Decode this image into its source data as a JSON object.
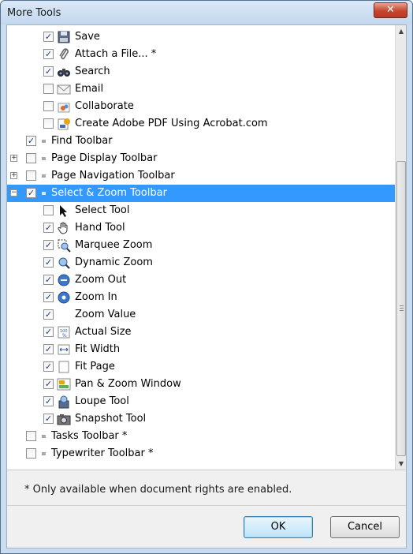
{
  "window": {
    "title": "More Tools",
    "close_glyph": "✕"
  },
  "items": [
    {
      "label": "Save",
      "checked": true,
      "indent": 2,
      "icon": "save-icon",
      "expander": ""
    },
    {
      "label": "Attach a File... *",
      "checked": true,
      "indent": 2,
      "icon": "paperclip-icon",
      "expander": ""
    },
    {
      "label": "Search",
      "checked": true,
      "indent": 2,
      "icon": "binoculars-icon",
      "expander": ""
    },
    {
      "label": "Email",
      "checked": false,
      "indent": 2,
      "icon": "email-icon",
      "expander": ""
    },
    {
      "label": "Collaborate",
      "checked": false,
      "indent": 2,
      "icon": "collaborate-icon",
      "expander": ""
    },
    {
      "label": "Create Adobe PDF Using Acrobat.com",
      "checked": false,
      "indent": 2,
      "icon": "acrobat-com-icon",
      "expander": ""
    },
    {
      "label": "Find Toolbar",
      "checked": true,
      "indent": 1,
      "icon": "toolbar-dot-icon",
      "expander": ""
    },
    {
      "label": "Page Display Toolbar",
      "checked": false,
      "indent": 1,
      "icon": "toolbar-dot-icon",
      "expander": "+"
    },
    {
      "label": "Page Navigation Toolbar",
      "checked": false,
      "indent": 1,
      "icon": "toolbar-dot-icon",
      "expander": "+"
    },
    {
      "label": "Select & Zoom Toolbar",
      "checked": true,
      "indent": 1,
      "icon": "toolbar-dot-icon",
      "expander": "−",
      "selected": true
    },
    {
      "label": "Select Tool",
      "checked": false,
      "indent": 2,
      "icon": "arrow-cursor-icon",
      "expander": ""
    },
    {
      "label": "Hand Tool",
      "checked": true,
      "indent": 2,
      "icon": "hand-icon",
      "expander": ""
    },
    {
      "label": "Marquee Zoom",
      "checked": true,
      "indent": 2,
      "icon": "marquee-zoom-icon",
      "expander": ""
    },
    {
      "label": "Dynamic Zoom",
      "checked": true,
      "indent": 2,
      "icon": "dynamic-zoom-icon",
      "expander": ""
    },
    {
      "label": "Zoom Out",
      "checked": true,
      "indent": 2,
      "icon": "zoom-out-icon",
      "expander": ""
    },
    {
      "label": "Zoom In",
      "checked": true,
      "indent": 2,
      "icon": "zoom-in-icon",
      "expander": ""
    },
    {
      "label": "Zoom Value",
      "checked": true,
      "indent": 2,
      "icon": "",
      "expander": ""
    },
    {
      "label": "Actual Size",
      "checked": true,
      "indent": 2,
      "icon": "actual-size-icon",
      "expander": ""
    },
    {
      "label": "Fit Width",
      "checked": true,
      "indent": 2,
      "icon": "fit-width-icon",
      "expander": ""
    },
    {
      "label": "Fit Page",
      "checked": true,
      "indent": 2,
      "icon": "fit-page-icon",
      "expander": ""
    },
    {
      "label": "Pan & Zoom Window",
      "checked": true,
      "indent": 2,
      "icon": "pan-zoom-icon",
      "expander": ""
    },
    {
      "label": "Loupe Tool",
      "checked": true,
      "indent": 2,
      "icon": "loupe-icon",
      "expander": ""
    },
    {
      "label": "Snapshot Tool",
      "checked": true,
      "indent": 2,
      "icon": "camera-icon",
      "expander": ""
    },
    {
      "label": "Tasks Toolbar *",
      "checked": false,
      "indent": 1,
      "icon": "toolbar-dot-icon",
      "expander": ""
    },
    {
      "label": "Typewriter Toolbar *",
      "checked": false,
      "indent": 1,
      "icon": "toolbar-dot-icon",
      "expander": ""
    }
  ],
  "check_glyph": "✓",
  "footnote": "* Only available when document rights are enabled.",
  "buttons": {
    "ok": "OK",
    "cancel": "Cancel"
  },
  "colors": {
    "selection": "#3399ff",
    "selection_text": "#ffffff"
  }
}
